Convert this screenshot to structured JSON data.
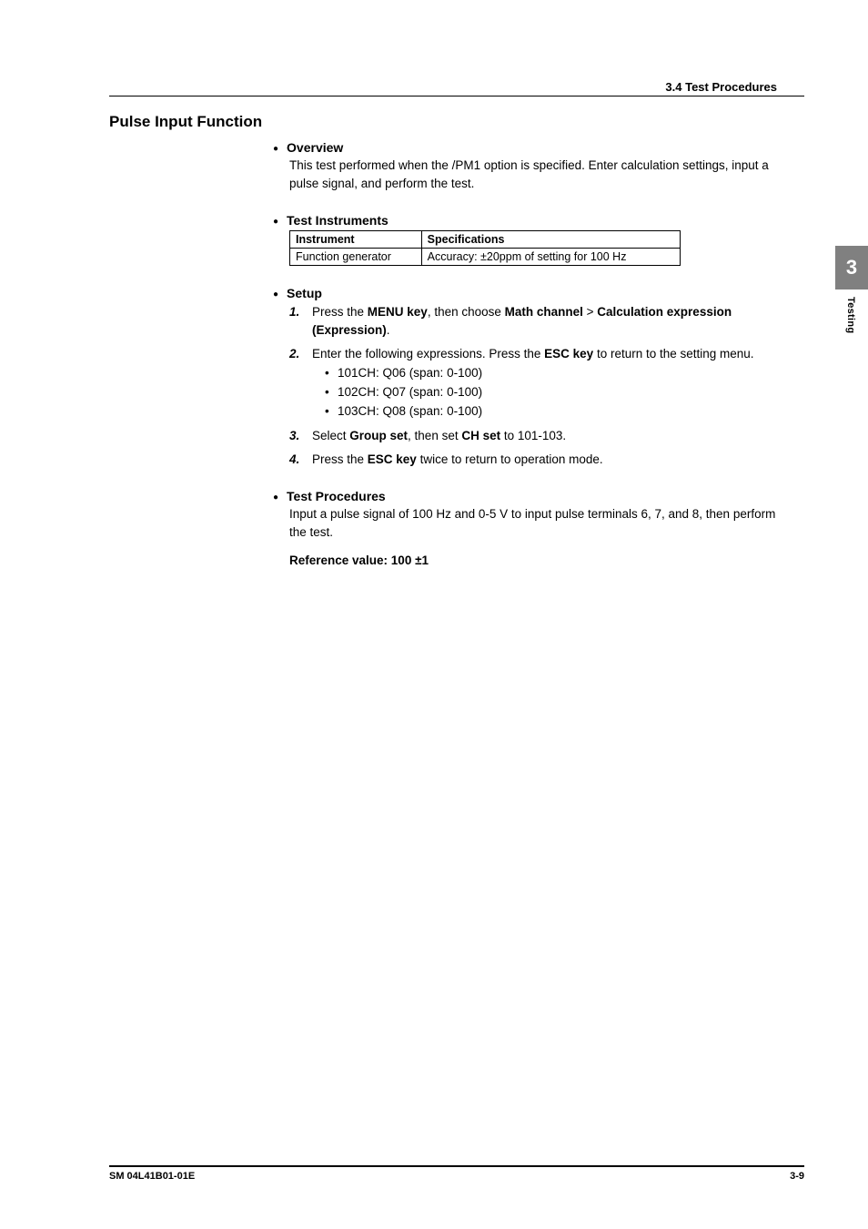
{
  "header": {
    "section_ref": "3.4  Test Procedures"
  },
  "title": "Pulse Input Function",
  "overview": {
    "heading": "Overview",
    "text": "This test performed when the /PM1 option is specified. Enter calculation settings, input a pulse signal, and perform the test."
  },
  "instruments": {
    "heading": "Test Instruments",
    "col1": "Instrument",
    "col2": "Specifications",
    "rows": [
      {
        "name": "Function generator",
        "spec": "Accuracy: ±20ppm of setting for 100 Hz"
      }
    ]
  },
  "setup": {
    "heading": "Setup",
    "steps": [
      {
        "num": "1.",
        "segments": [
          {
            "t": "Press the "
          },
          {
            "t": "MENU key",
            "b": true
          },
          {
            "t": ", then choose "
          },
          {
            "t": "Math channel",
            "b": true
          },
          {
            "t": " > "
          },
          {
            "t": "Calculation expression (Expression)",
            "b": true
          },
          {
            "t": "."
          }
        ]
      },
      {
        "num": "2.",
        "segments": [
          {
            "t": "Enter the following expressions. Press the "
          },
          {
            "t": "ESC key",
            "b": true
          },
          {
            "t": " to return to the setting menu."
          }
        ],
        "bullets": [
          "101CH: Q06 (span: 0-100)",
          "102CH: Q07 (span: 0-100)",
          "103CH: Q08 (span: 0-100)"
        ]
      },
      {
        "num": "3.",
        "segments": [
          {
            "t": "Select "
          },
          {
            "t": "Group set",
            "b": true
          },
          {
            "t": ", then set "
          },
          {
            "t": "CH set",
            "b": true
          },
          {
            "t": " to 101-103."
          }
        ]
      },
      {
        "num": "4.",
        "segments": [
          {
            "t": "Press the "
          },
          {
            "t": "ESC key",
            "b": true
          },
          {
            "t": " twice to return to operation mode."
          }
        ]
      }
    ]
  },
  "procedures": {
    "heading": "Test Procedures",
    "text": "Input a pulse signal of 100 Hz and 0-5 V to input pulse terminals 6, 7, and 8, then perform the test.",
    "reference": "Reference value: 100 ±1"
  },
  "tab": {
    "number": "3",
    "label": "Testing"
  },
  "footer": {
    "left": "SM 04L41B01-01E",
    "right": "3-9"
  }
}
